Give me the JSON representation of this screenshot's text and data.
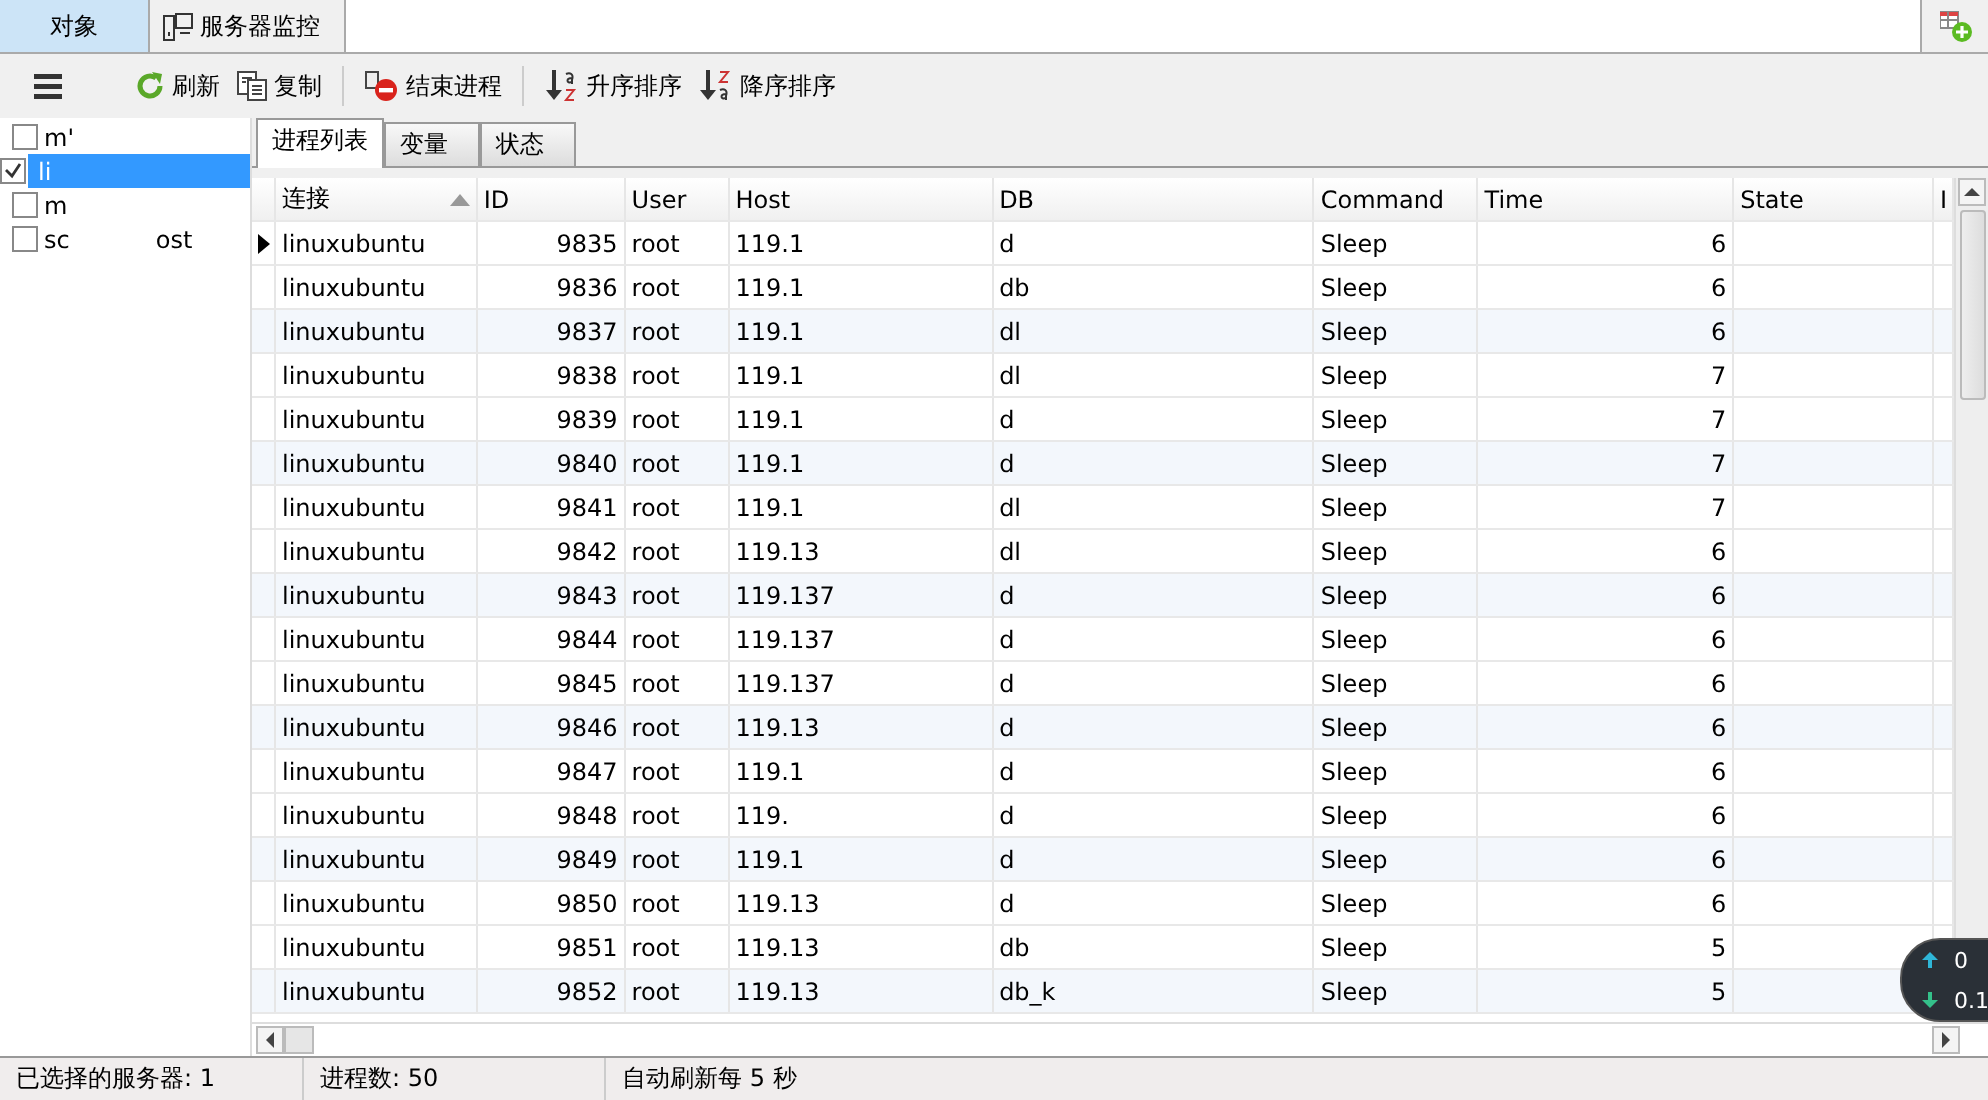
{
  "top_tabs": [
    {
      "label": "对象",
      "selected": true,
      "kind": "plain"
    },
    {
      "label": "服务器监控",
      "selected": false,
      "kind": "monitor"
    }
  ],
  "toolbar": [
    {
      "label": "刷新",
      "kind": "refresh"
    },
    {
      "label": "复制",
      "kind": "copy"
    },
    {
      "label": "结束进程",
      "kind": "kill"
    },
    {
      "label": "升序排序",
      "kind": "asc"
    },
    {
      "label": "降序排序",
      "kind": "desc"
    }
  ],
  "servers": [
    {
      "parts": [
        "m'"
      ],
      "checked": false,
      "selected": false
    },
    {
      "parts": [
        "li"
      ],
      "checked": true,
      "selected": true
    },
    {
      "parts": [
        "m"
      ],
      "checked": false,
      "selected": false
    },
    {
      "parts": [
        "sc",
        "ost"
      ],
      "checked": false,
      "selected": false
    }
  ],
  "sub_tabs": [
    {
      "label": "进程列表",
      "selected": true
    },
    {
      "label": "变量",
      "selected": false
    },
    {
      "label": "状态",
      "selected": false
    }
  ],
  "table": {
    "columns": [
      "连接",
      "ID",
      "User",
      "Host",
      "DB",
      "Command",
      "Time",
      "State",
      "I"
    ],
    "rows": [
      {
        "current": true,
        "cells": [
          "linuxubuntu",
          "9835",
          "root",
          "119.1",
          "d",
          "Sleep",
          "6",
          ""
        ]
      },
      {
        "current": false,
        "cells": [
          "linuxubuntu",
          "9836",
          "root",
          "119.1",
          "db",
          "Sleep",
          "6",
          ""
        ]
      },
      {
        "current": false,
        "cells": [
          "linuxubuntu",
          "9837",
          "root",
          "119.1",
          "dl",
          "Sleep",
          "6",
          ""
        ]
      },
      {
        "current": false,
        "cells": [
          "linuxubuntu",
          "9838",
          "root",
          "119.1",
          "dl",
          "Sleep",
          "7",
          ""
        ]
      },
      {
        "current": false,
        "cells": [
          "linuxubuntu",
          "9839",
          "root",
          "119.1",
          "d",
          "Sleep",
          "7",
          ""
        ]
      },
      {
        "current": false,
        "cells": [
          "linuxubuntu",
          "9840",
          "root",
          "119.1",
          "d",
          "Sleep",
          "7",
          ""
        ]
      },
      {
        "current": false,
        "cells": [
          "linuxubuntu",
          "9841",
          "root",
          "119.1",
          "dl",
          "Sleep",
          "7",
          ""
        ]
      },
      {
        "current": false,
        "cells": [
          "linuxubuntu",
          "9842",
          "root",
          "119.13",
          "dl",
          "Sleep",
          "6",
          ""
        ]
      },
      {
        "current": false,
        "cells": [
          "linuxubuntu",
          "9843",
          "root",
          "119.137",
          "d",
          "Sleep",
          "6",
          ""
        ]
      },
      {
        "current": false,
        "cells": [
          "linuxubuntu",
          "9844",
          "root",
          "119.137",
          "d",
          "Sleep",
          "6",
          ""
        ]
      },
      {
        "current": false,
        "cells": [
          "linuxubuntu",
          "9845",
          "root",
          "119.137",
          "d",
          "Sleep",
          "6",
          ""
        ]
      },
      {
        "current": false,
        "cells": [
          "linuxubuntu",
          "9846",
          "root",
          "119.13",
          "d",
          "Sleep",
          "6",
          ""
        ]
      },
      {
        "current": false,
        "cells": [
          "linuxubuntu",
          "9847",
          "root",
          "119.1",
          "d",
          "Sleep",
          "6",
          ""
        ]
      },
      {
        "current": false,
        "cells": [
          "linuxubuntu",
          "9848",
          "root",
          "119.",
          "d",
          "Sleep",
          "6",
          ""
        ]
      },
      {
        "current": false,
        "cells": [
          "linuxubuntu",
          "9849",
          "root",
          "119.1",
          "d",
          "Sleep",
          "6",
          ""
        ]
      },
      {
        "current": false,
        "cells": [
          "linuxubuntu",
          "9850",
          "root",
          "119.13",
          "d",
          "Sleep",
          "6",
          ""
        ]
      },
      {
        "current": false,
        "cells": [
          "linuxubuntu",
          "9851",
          "root",
          "119.13",
          "db",
          "Sleep",
          "5",
          ""
        ]
      },
      {
        "current": false,
        "cells": [
          "linuxubuntu",
          "9852",
          "root",
          "119.13",
          "db_k",
          "Sleep",
          "5",
          ""
        ]
      }
    ]
  },
  "net_speed": {
    "up": "0",
    "down": "0.1"
  },
  "status_bar": [
    "已选择的服务器: 1",
    "进程数: 50",
    "自动刷新每 5 秒"
  ]
}
